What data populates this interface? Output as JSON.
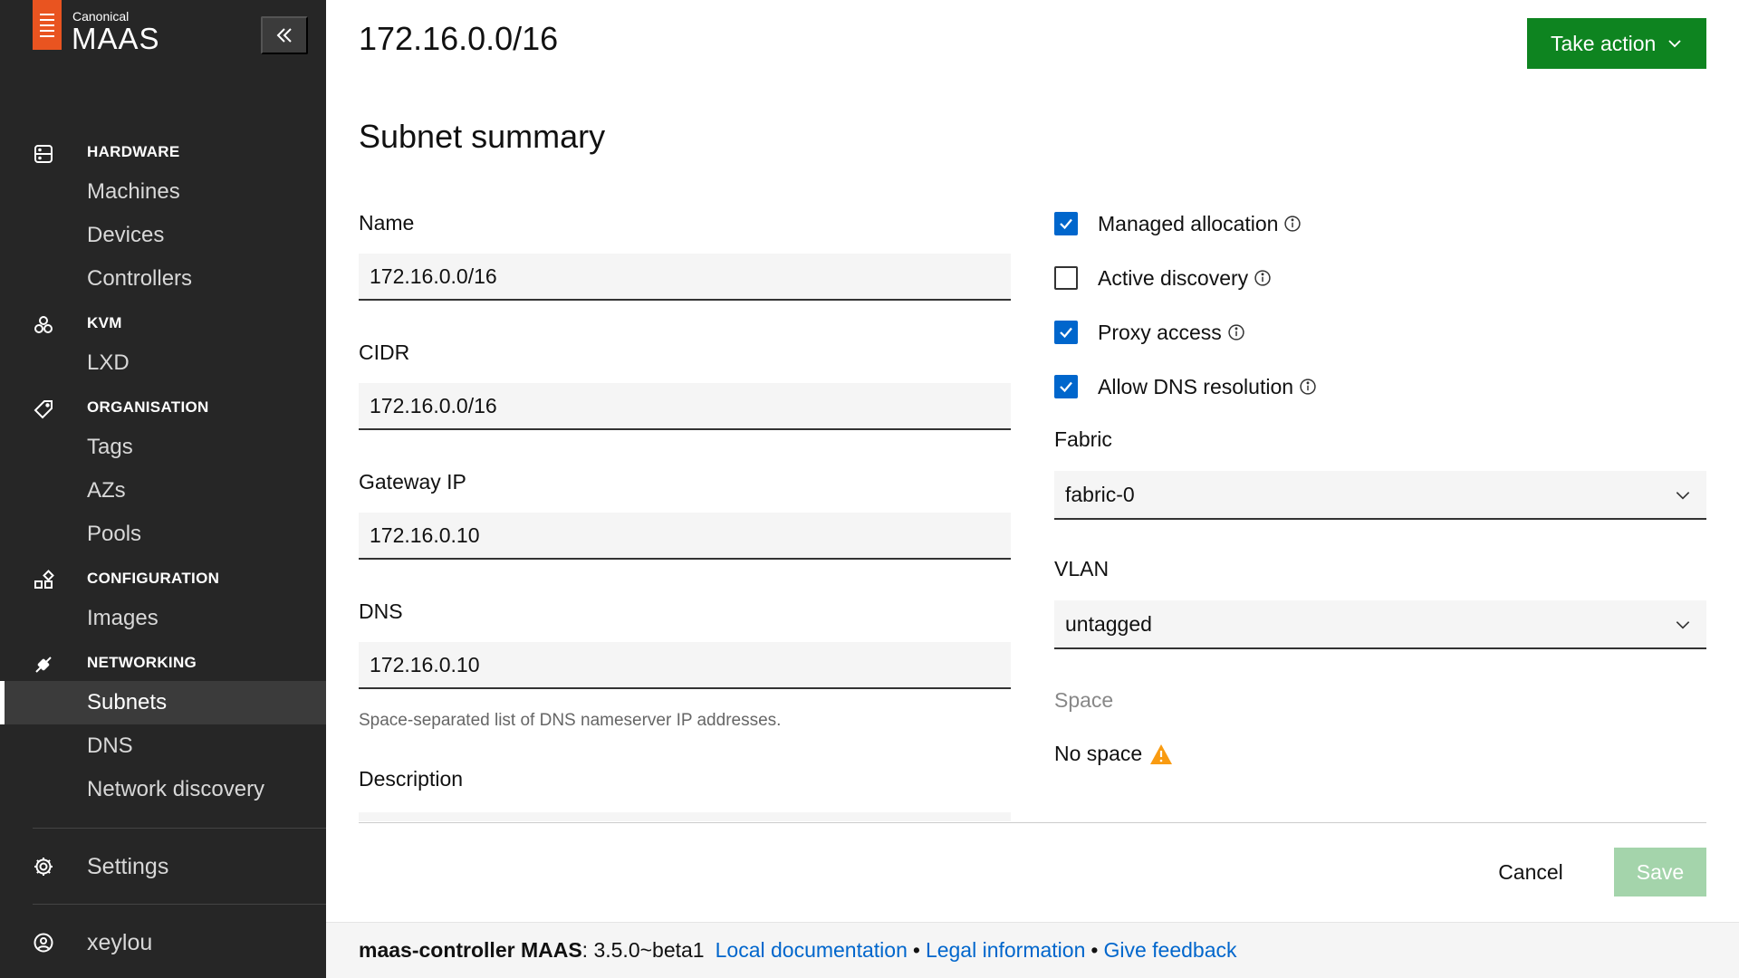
{
  "sidebar": {
    "brand_sub": "Canonical",
    "brand": "MAAS",
    "groups": [
      {
        "title": "HARDWARE",
        "icon": "server-icon",
        "items": [
          "Machines",
          "Devices",
          "Controllers"
        ]
      },
      {
        "title": "KVM",
        "icon": "cluster-icon",
        "items": [
          "LXD"
        ]
      },
      {
        "title": "ORGANISATION",
        "icon": "tag-icon",
        "items": [
          "Tags",
          "AZs",
          "Pools"
        ]
      },
      {
        "title": "CONFIGURATION",
        "icon": "config-icon",
        "items": [
          "Images"
        ]
      },
      {
        "title": "NETWORKING",
        "icon": "network-icon",
        "items": [
          "Subnets",
          "DNS",
          "Network discovery"
        ]
      }
    ],
    "active_item": "Subnets",
    "settings_label": "Settings",
    "user_label": "xeylou"
  },
  "header": {
    "title": "172.16.0.0/16",
    "take_action": "Take action"
  },
  "form": {
    "section_title": "Subnet summary",
    "name_label": "Name",
    "name_value": "172.16.0.0/16",
    "cidr_label": "CIDR",
    "cidr_value": "172.16.0.0/16",
    "gateway_label": "Gateway IP",
    "gateway_value": "172.16.0.10",
    "dns_label": "DNS",
    "dns_value": "172.16.0.10",
    "dns_help": "Space-separated list of DNS nameserver IP addresses.",
    "description_label": "Description",
    "checkboxes": [
      {
        "label": "Managed allocation",
        "checked": true
      },
      {
        "label": "Active discovery",
        "checked": false
      },
      {
        "label": "Proxy access",
        "checked": true
      },
      {
        "label": "Allow DNS resolution",
        "checked": true
      }
    ],
    "fabric_label": "Fabric",
    "fabric_value": "fabric-0",
    "vlan_label": "VLAN",
    "vlan_value": "untagged",
    "space_label": "Space",
    "space_value": "No space",
    "cancel": "Cancel",
    "save": "Save"
  },
  "footer": {
    "controller": "maas-controller MAAS",
    "version": ": 3.5.0~beta1",
    "links": [
      "Local documentation",
      "Legal information",
      "Give feedback"
    ],
    "separator": "•"
  },
  "colors": {
    "sidebar_bg": "#262626",
    "brand_orange": "#e95420",
    "action_green": "#0e8420",
    "save_disabled": "#a4d4ab",
    "link_blue": "#0066cc",
    "checkbox_blue": "#0066cc",
    "warning": "#f99b11"
  }
}
